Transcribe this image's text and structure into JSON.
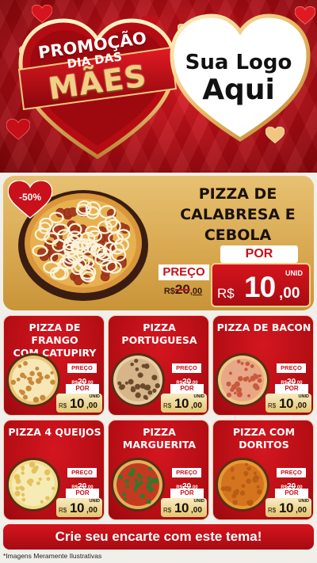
{
  "header": {
    "promo_l1": "PROMOÇÃO",
    "promo_l2": "DIA DAS",
    "promo_l3": "MÃES",
    "logo_l1": "Sua Logo",
    "logo_l2": "Aqui"
  },
  "featured": {
    "discount": "-50%",
    "name": [
      "PIZZA DE",
      "CALABRESA E",
      "CEBOLA"
    ],
    "por_label": "POR",
    "preco_label": "PREÇO",
    "old_price": {
      "currency": "R$",
      "int": "20",
      "dec": ",00"
    },
    "new_price": {
      "currency": "R$",
      "int": "10",
      "dec": ",00",
      "unit": "UNID"
    }
  },
  "cards": [
    {
      "name": [
        "PIZZA DE FRANGO",
        "COM CATUPIRY"
      ],
      "preco_label": "PREÇO",
      "old": {
        "currency": "R$",
        "int": "20",
        "dec": ",00"
      },
      "por_label": "POR",
      "new": {
        "currency": "R$",
        "int": "10",
        "dec": ",00",
        "unit": "UNID"
      }
    },
    {
      "name": [
        "PIZZA",
        "PORTUGUESA"
      ],
      "preco_label": "PREÇO",
      "old": {
        "currency": "R$",
        "int": "20",
        "dec": ",00"
      },
      "por_label": "POR",
      "new": {
        "currency": "R$",
        "int": "10",
        "dec": ",00",
        "unit": "UNID"
      }
    },
    {
      "name": [
        "PIZZA DE BACON",
        ""
      ],
      "preco_label": "PREÇO",
      "old": {
        "currency": "R$",
        "int": "20",
        "dec": ",00"
      },
      "por_label": "POR",
      "new": {
        "currency": "R$",
        "int": "10",
        "dec": ",00",
        "unit": "UNID"
      }
    },
    {
      "name": [
        "PIZZA 4 QUEIJOS",
        ""
      ],
      "preco_label": "PREÇO",
      "old": {
        "currency": "R$",
        "int": "20",
        "dec": ",00"
      },
      "por_label": "POR",
      "new": {
        "currency": "R$",
        "int": "10",
        "dec": ",00",
        "unit": "UNID"
      }
    },
    {
      "name": [
        "PIZZA",
        "MARGUERITA"
      ],
      "preco_label": "PREÇO",
      "old": {
        "currency": "R$",
        "int": "20",
        "dec": ",00"
      },
      "por_label": "POR",
      "new": {
        "currency": "R$",
        "int": "10",
        "dec": ",00",
        "unit": "UNID"
      }
    },
    {
      "name": [
        "PIZZA COM",
        "DORITOS"
      ],
      "preco_label": "PREÇO",
      "old": {
        "currency": "R$",
        "int": "20",
        "dec": ",00"
      },
      "por_label": "POR",
      "new": {
        "currency": "R$",
        "int": "10",
        "dec": ",00",
        "unit": "UNID"
      }
    }
  ],
  "footer": {
    "cta": "Crie seu encarte com este tema!",
    "disclaimer": "*Imagens Meramente Ilustrativas"
  },
  "colors": {
    "brand_red": "#c8111a",
    "gold": "#d9a951",
    "cream": "#f1efe9"
  },
  "icons": [
    "heart-icon",
    "pizza-image",
    "discount-badge"
  ]
}
